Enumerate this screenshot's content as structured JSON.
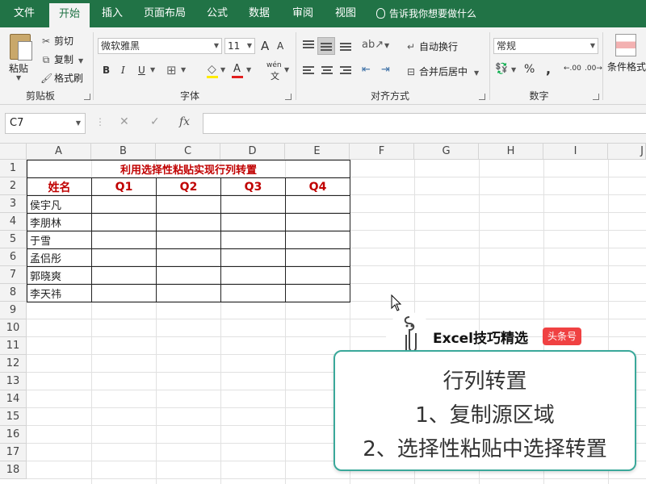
{
  "ribbon_tabs": [
    "文件",
    "开始",
    "插入",
    "页面布局",
    "公式",
    "数据",
    "审阅",
    "视图"
  ],
  "tell_me": "告诉我你想要做什么",
  "clipboard": {
    "paste": "粘贴",
    "cut": "剪切",
    "copy": "复制",
    "format_painter": "格式刷",
    "group": "剪贴板"
  },
  "font": {
    "name": "微软雅黑",
    "size": "11",
    "grow": "A",
    "shrink": "A",
    "bold": "B",
    "italic": "I",
    "underline": "U",
    "font_color": "A",
    "phonetic": "wén",
    "group": "字体"
  },
  "alignment": {
    "wrap": "自动换行",
    "merge": "合并后居中",
    "group": "对齐方式"
  },
  "number": {
    "format": "常规",
    "percent": "%",
    "comma": ",",
    "inc_decimal": "←.00",
    "dec_decimal": ".00→",
    "group": "数字"
  },
  "styles": {
    "conditional": "条件格式"
  },
  "formula_bar": {
    "name_box": "C7",
    "fx": "fx",
    "value": ""
  },
  "columns": [
    "A",
    "B",
    "C",
    "D",
    "E",
    "F",
    "G",
    "H",
    "I",
    "J"
  ],
  "rows": [
    "1",
    "2",
    "3",
    "4",
    "5",
    "6",
    "7",
    "8",
    "9",
    "10",
    "11",
    "12",
    "13",
    "14",
    "15",
    "16",
    "17",
    "18"
  ],
  "sheet": {
    "title": "利用选择性粘贴实现行列转置",
    "header": [
      "姓名",
      "Q1",
      "Q2",
      "Q3",
      "Q4"
    ],
    "names": [
      "侯宇凡",
      "李朋林",
      "于雪",
      "孟侣彤",
      "郭晓爽",
      "李天祎"
    ]
  },
  "overlay": {
    "brand": "Excel技巧精选",
    "badge": "头条号",
    "lines": [
      "行列转置",
      "1、复制源区域",
      "2、选择性粘贴中选择转置"
    ]
  },
  "colors": {
    "excel_green": "#217346",
    "title_red": "#c00000",
    "card_border": "#3aa89a",
    "badge_red": "#f04142"
  }
}
